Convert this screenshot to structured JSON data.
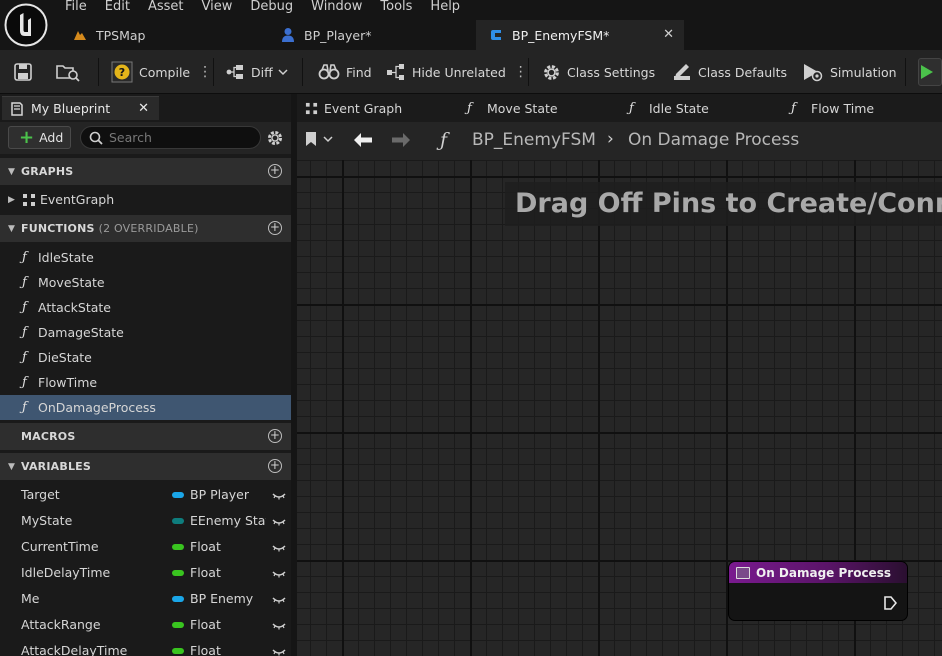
{
  "menu": [
    "File",
    "Edit",
    "Asset",
    "View",
    "Debug",
    "Window",
    "Tools",
    "Help"
  ],
  "doc_tabs": [
    {
      "label": "TPSMap"
    },
    {
      "label": "BP_Player*"
    },
    {
      "label": "BP_EnemyFSM*"
    }
  ],
  "toolbar": {
    "compile": "Compile",
    "diff": "Diff",
    "find": "Find",
    "hide_unrelated": "Hide Unrelated",
    "class_settings": "Class Settings",
    "class_defaults": "Class Defaults",
    "simulation": "Simulation"
  },
  "left_panel": {
    "tab_label": "My Blueprint",
    "add_label": "Add",
    "search_placeholder": "Search",
    "graphs_header": "GRAPHS",
    "event_graph": "EventGraph",
    "functions_header": "FUNCTIONS",
    "functions_sub": "(2 OVERRIDABLE)",
    "functions": [
      "IdleState",
      "MoveState",
      "AttackState",
      "DamageState",
      "DieState",
      "FlowTime",
      "OnDamageProcess"
    ],
    "selected_function": "OnDamageProcess",
    "macros_header": "MACROS",
    "variables_header": "VARIABLES",
    "variables": [
      {
        "name": "Target",
        "type": "BP Player",
        "color": "#1aa6e8"
      },
      {
        "name": "MyState",
        "type": "EEnemy State",
        "color": "#0e7d7d"
      },
      {
        "name": "CurrentTime",
        "type": "Float",
        "color": "#39c41f"
      },
      {
        "name": "IdleDelayTime",
        "type": "Float",
        "color": "#39c41f"
      },
      {
        "name": "Me",
        "type": "BP Enemy",
        "color": "#1aa6e8"
      },
      {
        "name": "AttackRange",
        "type": "Float",
        "color": "#39c41f"
      },
      {
        "name": "AttackDelayTime",
        "type": "Float",
        "color": "#39c41f"
      }
    ]
  },
  "graph": {
    "tabs": [
      "Event Graph",
      "Move State",
      "Idle State",
      "Flow Time"
    ],
    "breadcrumb_root": "BP_EnemyFSM",
    "breadcrumb_current": "On Damage Process",
    "hint": "Drag Off Pins to Create/Connect New Nodes.",
    "node_title": "On Damage Process"
  },
  "colors": {
    "accent_green": "#4bc24b",
    "selection": "#3f5671",
    "node_header": "#7a1a8f"
  }
}
